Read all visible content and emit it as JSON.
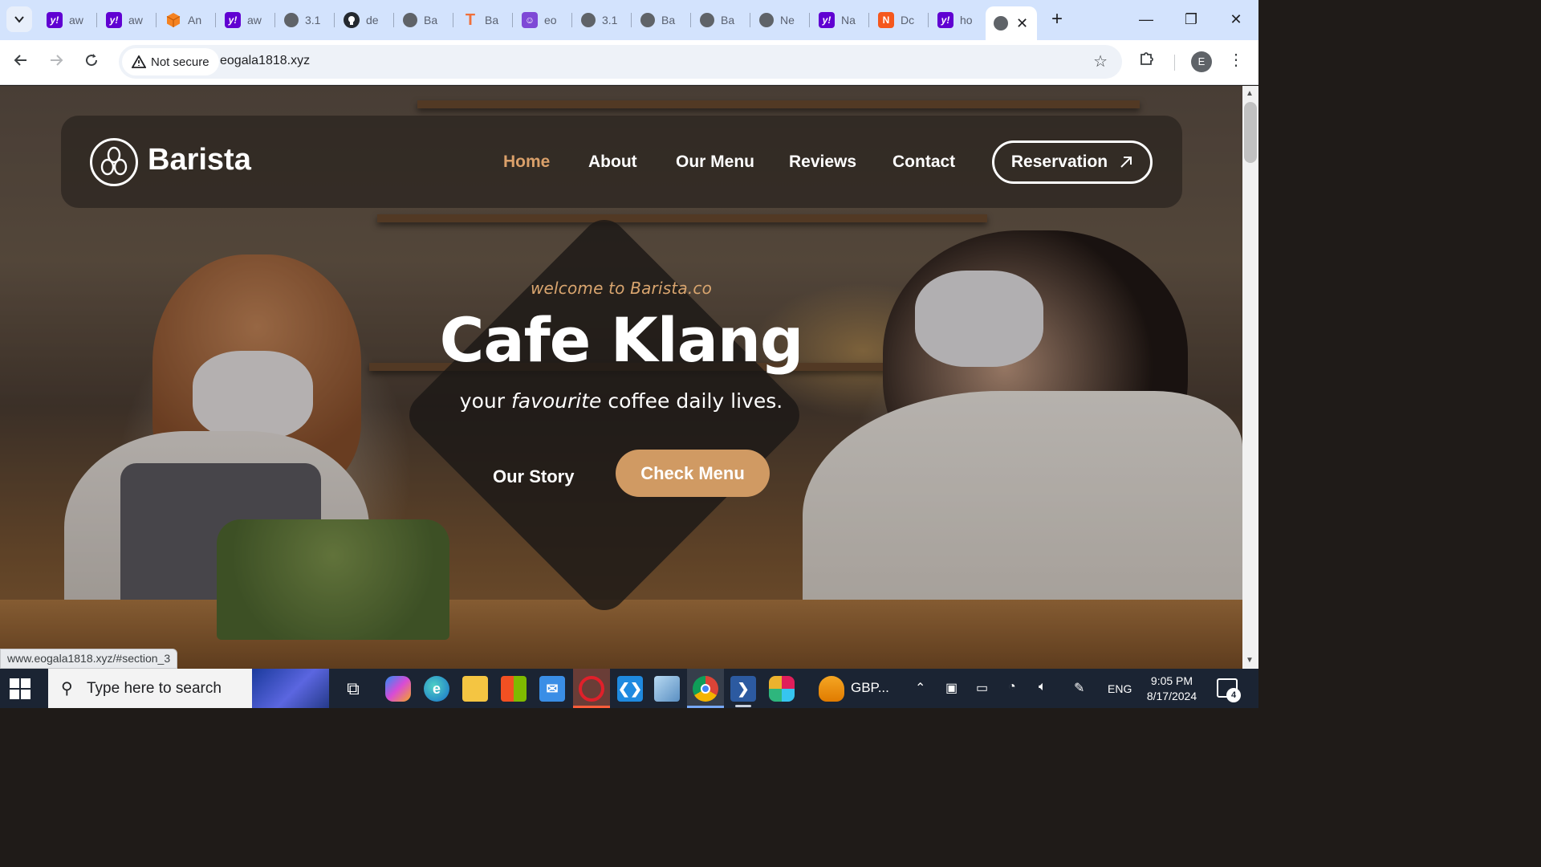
{
  "browser": {
    "tabs": [
      {
        "icon": "yahoo-icon",
        "title": "aw"
      },
      {
        "icon": "yahoo-icon",
        "title": "aw"
      },
      {
        "icon": "package-icon",
        "title": "An"
      },
      {
        "icon": "yahoo-icon",
        "title": "aw"
      },
      {
        "icon": "globe-icon",
        "title": "3.1"
      },
      {
        "icon": "github-icon",
        "title": "de"
      },
      {
        "icon": "globe-icon",
        "title": "Ba"
      },
      {
        "icon": "t-letter-icon",
        "title": "Ba"
      },
      {
        "icon": "cat-icon",
        "title": "eo"
      },
      {
        "icon": "globe-icon",
        "title": "3.1"
      },
      {
        "icon": "globe-icon",
        "title": "Ba"
      },
      {
        "icon": "globe-icon",
        "title": "Ba"
      },
      {
        "icon": "globe-icon",
        "title": "Ne"
      },
      {
        "icon": "yahoo-icon",
        "title": "Na"
      },
      {
        "icon": "nv-icon",
        "title": "Dc"
      },
      {
        "icon": "yahoo-icon",
        "title": "ho"
      }
    ],
    "security_label": "Not secure",
    "url": "eogala1818.xyz",
    "profile_initial": "E",
    "status_url": "www.eogala1818.xyz/#section_3"
  },
  "page": {
    "brand": "Barista",
    "nav": [
      "Home",
      "About",
      "Our Menu",
      "Reviews",
      "Contact"
    ],
    "active_nav": "Home",
    "reservation_label": "Reservation",
    "welcome": "welcome to Barista.co",
    "title": "Cafe Klang",
    "subtitle_before": "your ",
    "subtitle_em": "favourite",
    "subtitle_after": " coffee daily lives.",
    "story_button": "Our Story",
    "menu_button": "Check Menu",
    "colors": {
      "accent": "#d09a63",
      "nav_active": "#daa06a"
    }
  },
  "taskbar": {
    "search_placeholder": "Type here to search",
    "currency_label": "GBP...",
    "language": "ENG",
    "time": "9:05 PM",
    "date": "8/17/2024",
    "notification_count": "4"
  }
}
